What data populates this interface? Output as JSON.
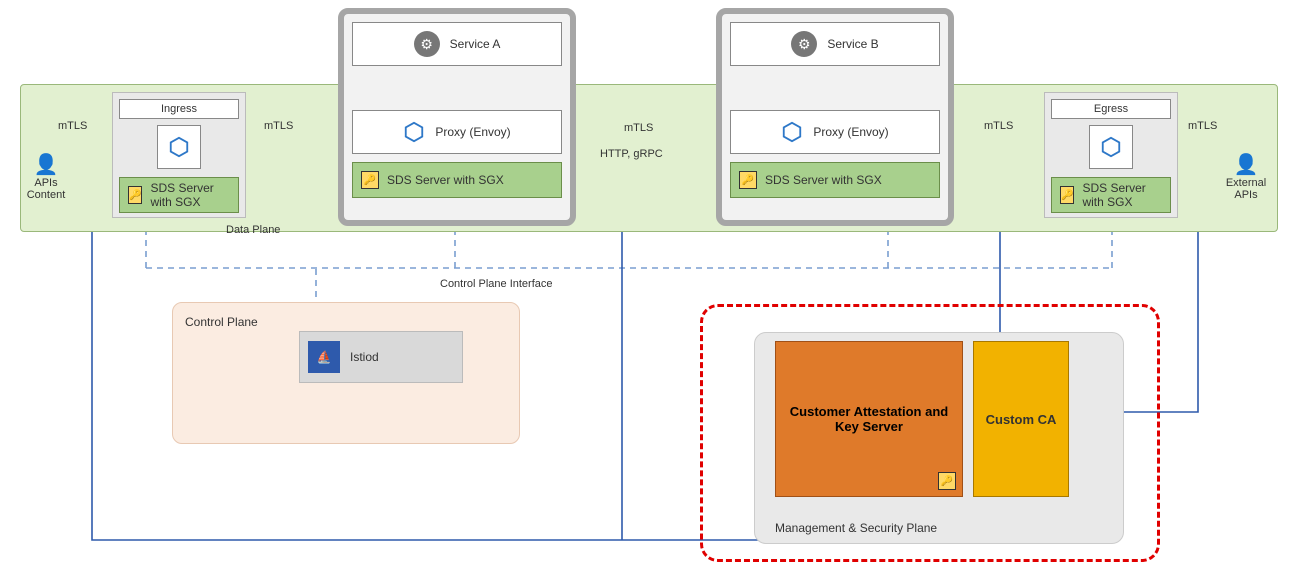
{
  "dataPlane": {
    "label": "Data Plane"
  },
  "serviceA": {
    "title": "Service A",
    "proxy": "Proxy (Envoy)",
    "sds": "SDS Server with SGX"
  },
  "serviceB": {
    "title": "Service B",
    "proxy": "Proxy (Envoy)",
    "sds": "SDS Server with SGX"
  },
  "ingress": {
    "label": "Ingress",
    "sds": "SDS Server with SGX"
  },
  "egress": {
    "label": "Egress",
    "sds": "SDS Server with  SGX"
  },
  "controlPlane": {
    "label": "Control Plane",
    "istiod": "Istiod",
    "iface": "Control Plane Interface"
  },
  "mgmtPlane": {
    "label": "Management & Security Plane",
    "attest": "Customer Attestation and Key Server",
    "ca": "Custom CA"
  },
  "actors": {
    "left": "APIs Content",
    "right": "External APIs"
  },
  "edge": {
    "mtls": "mTLS",
    "http": "HTTP, gRPC"
  }
}
